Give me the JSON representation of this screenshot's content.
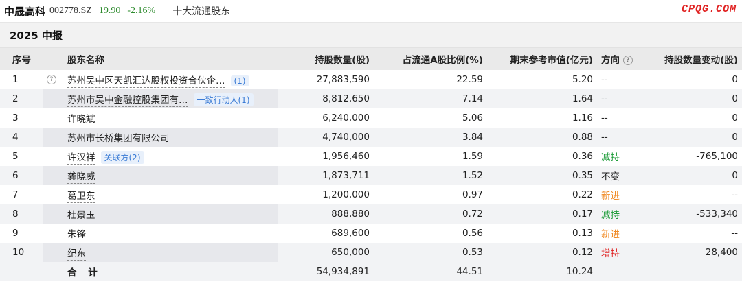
{
  "header": {
    "stock_name": "中晟高科",
    "stock_code": "002778.SZ",
    "price": "19.90",
    "change": "-2.16%",
    "section_title": "十大流通股东",
    "watermark": "CPQG.COM",
    "price_color": "#2e8b2e",
    "watermark_color": "#e02020"
  },
  "period": {
    "title": "2025 中报"
  },
  "table": {
    "columns": {
      "idx": "序号",
      "name": "股东名称",
      "shares": "持股数量(股)",
      "ratio": "占流通A股比例(%)",
      "value": "期末参考市值(亿元)",
      "direction": "方向",
      "change": "持股数量变动(股)"
    },
    "rows": [
      {
        "idx": "1",
        "name": "苏州吴中区天凯汇达股权投资合伙企…",
        "tag": "(1)",
        "shares": "27,883,590",
        "ratio": "22.59",
        "value": "5.20",
        "direction": "--",
        "dir_class": "dir-same",
        "change": "0"
      },
      {
        "idx": "2",
        "name": "苏州市吴中金融控股集团有…",
        "tag": "一致行动人(1)",
        "shares": "8,812,650",
        "ratio": "7.14",
        "value": "1.64",
        "direction": "--",
        "dir_class": "dir-same",
        "change": "0"
      },
      {
        "idx": "3",
        "name": "许晓斌",
        "tag": "",
        "shares": "6,240,000",
        "ratio": "5.06",
        "value": "1.16",
        "direction": "--",
        "dir_class": "dir-same",
        "change": "0"
      },
      {
        "idx": "4",
        "name": "苏州市长桥集团有限公司",
        "tag": "",
        "shares": "4,740,000",
        "ratio": "3.84",
        "value": "0.88",
        "direction": "--",
        "dir_class": "dir-same",
        "change": "0"
      },
      {
        "idx": "5",
        "name": "许汉祥",
        "tag": "关联方(2)",
        "shares": "1,956,460",
        "ratio": "1.59",
        "value": "0.36",
        "direction": "减持",
        "dir_class": "dir-decrease",
        "change": "-765,100"
      },
      {
        "idx": "6",
        "name": "龚晓威",
        "tag": "",
        "shares": "1,873,711",
        "ratio": "1.52",
        "value": "0.35",
        "direction": "不变",
        "dir_class": "dir-same",
        "change": "0"
      },
      {
        "idx": "7",
        "name": "葛卫东",
        "tag": "",
        "shares": "1,200,000",
        "ratio": "0.97",
        "value": "0.22",
        "direction": "新进",
        "dir_class": "dir-new",
        "change": "--"
      },
      {
        "idx": "8",
        "name": "杜景玉",
        "tag": "",
        "shares": "888,880",
        "ratio": "0.72",
        "value": "0.17",
        "direction": "减持",
        "dir_class": "dir-decrease",
        "change": "-533,340"
      },
      {
        "idx": "9",
        "name": "朱锋",
        "tag": "",
        "shares": "689,600",
        "ratio": "0.56",
        "value": "0.13",
        "direction": "新进",
        "dir_class": "dir-new",
        "change": "--"
      },
      {
        "idx": "10",
        "name": "纪东",
        "tag": "",
        "shares": "650,000",
        "ratio": "0.53",
        "value": "0.12",
        "direction": "增持",
        "dir_class": "dir-increase",
        "change": "28,400"
      }
    ],
    "total": {
      "label": "合 计",
      "shares": "54,934,891",
      "ratio": "44.51",
      "value": "10.24"
    }
  },
  "icons": {
    "help": "question-circle-icon"
  }
}
